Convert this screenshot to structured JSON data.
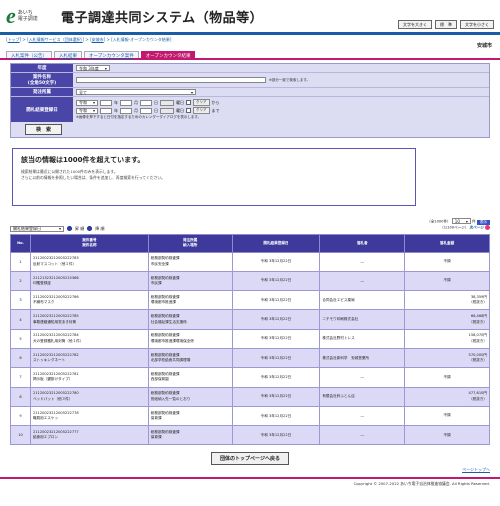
{
  "header": {
    "logo_letter": "e",
    "logo_line1": "あいち",
    "logo_line2": "電子調達",
    "title": "電子調達共同システム（物品等）",
    "btn_large_text": "文字を大きく",
    "btn_standard": "標　準",
    "btn_small_text": "文字を小さく"
  },
  "breadcrumb": {
    "top": "トップ",
    "info_service": "入札情報サービス（団体選択）",
    "city_link": "安城市",
    "current": "入札情報-オープンカウンタ結果",
    "sep": " > "
  },
  "city_name": "安城市",
  "tabs": [
    {
      "label": "入札案件（公告）"
    },
    {
      "label": "入札結果"
    },
    {
      "label": "オープンカウンタ案件"
    },
    {
      "label": "オープンカウンタ結果"
    }
  ],
  "search": {
    "year_label": "年度",
    "year_value": "令和 3年度",
    "case_label": "案件名称",
    "case_sub": "(全角50文字)",
    "case_note": "※部分一致で検索します。",
    "dept_label": "発注所属",
    "dept_value": "全て",
    "date_label": "開札結果登録日",
    "era": "令和",
    "year_unit": "年",
    "month_unit": "月",
    "day_unit": "日",
    "weekday_unit": "曜日",
    "clear": "クリア",
    "from": "から",
    "to": "まで",
    "date_note": "※画像を押下すると日付を指定するためのカレンダーダイアログを表示します。",
    "search_button": "検　索"
  },
  "message": {
    "title": "該当の情報は1000件を超えています。",
    "line1": "検索結果は最近に公開された1000件のみを表示します。",
    "line2": "さらに以前の情報を参照したい場合は、条件を追加し、再度検索を行ってください。"
  },
  "sort": {
    "field": "開札結果登録日",
    "asc": "昇 順",
    "desc": "降 順"
  },
  "pager": {
    "total": "（全1000件）",
    "per_page": "10",
    "per_page_unit": "件",
    "display_button": "表示",
    "page": "（1/100ページ）",
    "next": "次ページ"
  },
  "table": {
    "headers": {
      "no": "No.",
      "case1": "案件番号",
      "case2": "案件名称",
      "dept1": "発注所属",
      "dept2": "納入場所",
      "date": "開札結果登録日",
      "vendor": "落札者",
      "amount": "落札金額"
    },
    "rows": [
      {
        "no": "1",
        "id": "21120023212005222783",
        "name": "反射マスコット（他１件）",
        "dept": "総務部契約検査課",
        "place": "市民安全課",
        "date": "令和 3年12月22日",
        "vendor": "―",
        "amount": "不調",
        "tax": ""
      },
      {
        "no": "2",
        "id": "21121323212005215366",
        "name": "印鑑登録証",
        "dept": "総務部契約検査課",
        "place": "市民課",
        "date": "令和 3年12月22日",
        "vendor": "―",
        "amount": "不調",
        "tax": ""
      },
      {
        "no": "3",
        "id": "21120023212005222786",
        "name": "不織布マスク",
        "dept": "総務部契約検査課",
        "place": "環境都市推進課",
        "date": "令和 3年12月22日",
        "vendor": "合同会社エピス薬局",
        "amount": "38,359円",
        "tax": "（税抜き）"
      },
      {
        "no": "4",
        "id": "21120023212005222785",
        "name": "事務連絡通知用窓あき封筒",
        "dept": "総務部契約検査課",
        "place": "社会福祉課生活支援係",
        "date": "令和 3年12月22日",
        "vendor": "ニチモウ印刷株式会社",
        "amount": "66,468円",
        "tax": "（税抜き）"
      },
      {
        "no": "5",
        "id": "21120023212005222784",
        "name": "犬の登録鑑札用封筒（他１件）",
        "dept": "総務部契約検査課",
        "place": "環境都市推進課環境保全係",
        "date": "令和 3年12月22日",
        "vendor": "株式会社野村トレス",
        "amount": "158,070円",
        "tax": "（税抜き）"
      },
      {
        "no": "6",
        "id": "21120023212005222782",
        "name": "ストッキングネート",
        "dept": "総務部契約検査課",
        "place": "北部学校給食共同調理場",
        "date": "令和 3年12月22日",
        "vendor": "株式会社新科学　安城営業所",
        "amount": "570,000円",
        "tax": "（税抜き）"
      },
      {
        "no": "7",
        "id": "21120023212005222781",
        "name": "掲示板（鍵掛けタイプ）",
        "dept": "総務部契約検査課",
        "place": "西部保育園",
        "date": "令和 3年12月22日",
        "vendor": "―",
        "amount": "不調",
        "tax": ""
      },
      {
        "no": "8",
        "id": "21120023212005222780",
        "name": "ベッドパット（他３件）",
        "dept": "総務部契約検査課",
        "place": "別紙納入先一覧のとおり",
        "date": "令和 3年12月22日",
        "vendor": "有限会社鈴ふとん店",
        "amount": "477,610円",
        "tax": "（税抜き）"
      },
      {
        "no": "9",
        "id": "21120023212005222778",
        "name": "職員用エスケッ",
        "dept": "総務部契約検査課",
        "place": "保育課",
        "date": "令和 3年12月22日",
        "vendor": "―",
        "amount": "不調",
        "tax": ""
      },
      {
        "no": "10",
        "id": "21120023212005222777",
        "name": "給食用エプロン",
        "dept": "総務部契約検査課",
        "place": "保育課",
        "date": "令和 3年12月22日",
        "vendor": "―",
        "amount": "不調",
        "tax": ""
      }
    ]
  },
  "top_button": "団体のトップページへ戻る",
  "page_top": "ページトップへ",
  "footer": "Copyright © 2007-2022 あいち電子自治体推進協議会. All Rights Reserved.",
  "colors": {
    "header_purple": "#3e3a9c",
    "accent_pink": "#c2196e",
    "row_alt": "#dbd9f5"
  }
}
